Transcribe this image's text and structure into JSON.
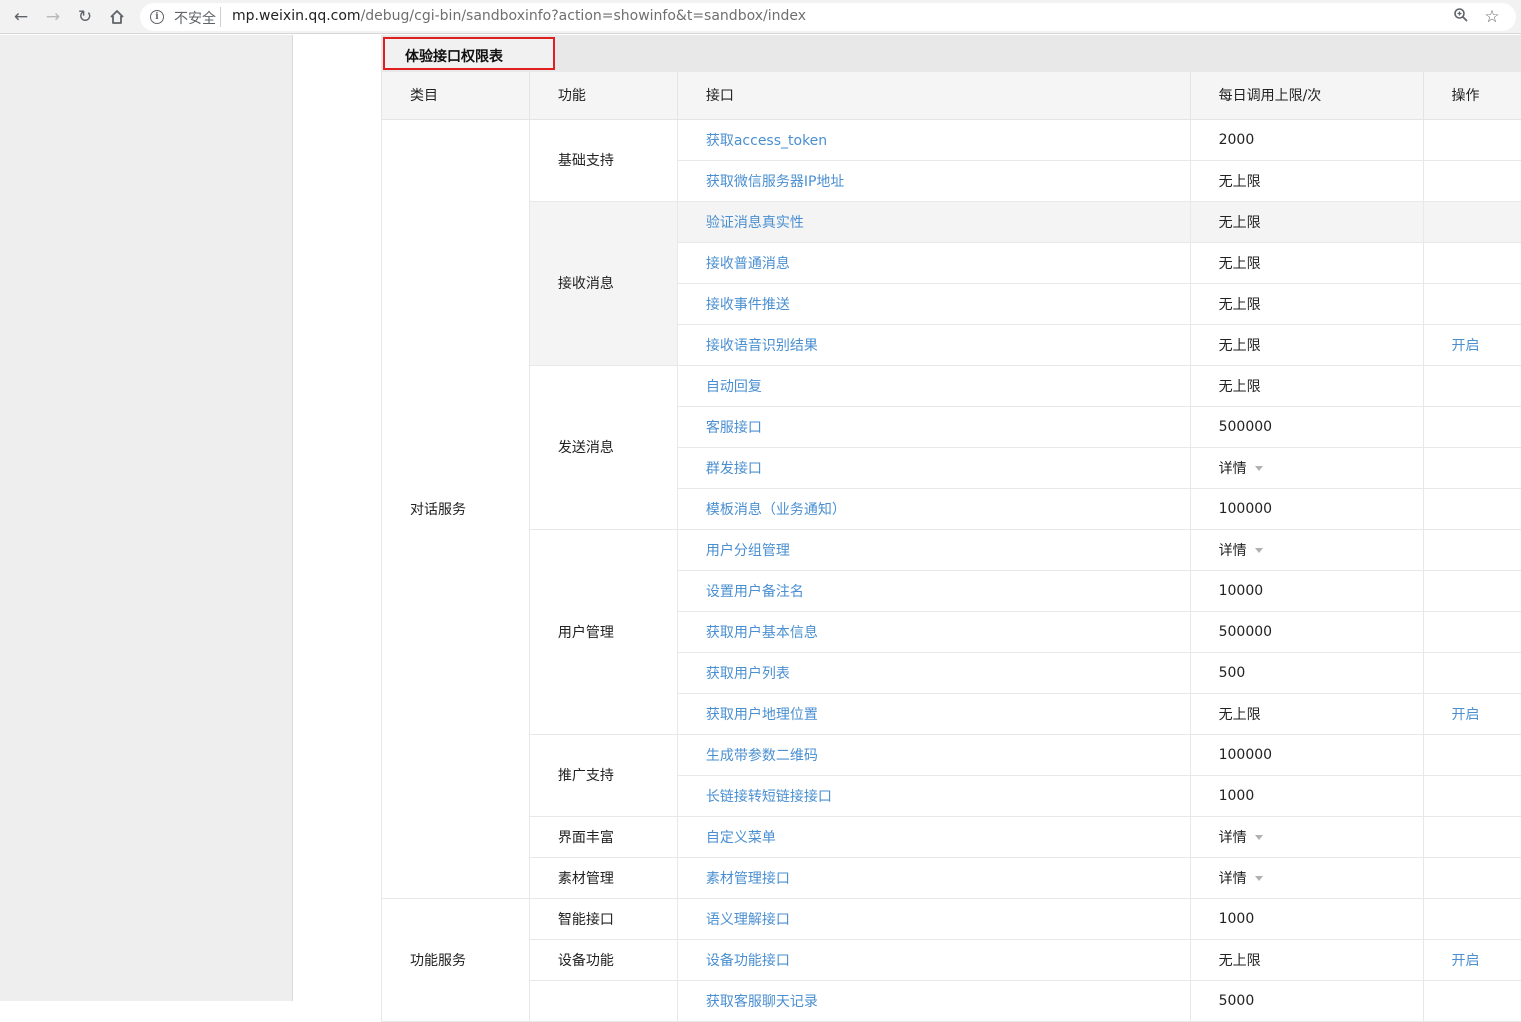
{
  "browser": {
    "security_label": "不安全",
    "url_host": "mp.weixin.qq.com",
    "url_path": "/debug/cgi-bin/sandboxinfo?action=showinfo&t=sandbox/index"
  },
  "page": {
    "title": "体验接口权限表"
  },
  "table": {
    "headers": {
      "category": "类目",
      "function": "功能",
      "api": "接口",
      "limit": "每日调用上限/次",
      "action": "操作"
    },
    "categories": [
      {
        "name": "对话服务",
        "groups": [
          {
            "name": "基础支持",
            "rows": [
              {
                "api": "获取access_token",
                "limit": "2000"
              },
              {
                "api": "获取微信服务器IP地址",
                "limit": "无上限"
              }
            ]
          },
          {
            "name": "接收消息",
            "rows": [
              {
                "api": "验证消息真实性",
                "limit": "无上限"
              },
              {
                "api": "接收普通消息",
                "limit": "无上限"
              },
              {
                "api": "接收事件推送",
                "limit": "无上限"
              },
              {
                "api": "接收语音识别结果",
                "limit": "无上限",
                "action": "开启"
              }
            ]
          },
          {
            "name": "发送消息",
            "rows": [
              {
                "api": "自动回复",
                "limit": "无上限"
              },
              {
                "api": "客服接口",
                "limit": "500000"
              },
              {
                "api": "群发接口",
                "limit": "详情",
                "dropdown": true
              },
              {
                "api": "模板消息（业务通知）",
                "limit": "100000"
              }
            ]
          },
          {
            "name": "用户管理",
            "rows": [
              {
                "api": "用户分组管理",
                "limit": "详情",
                "dropdown": true
              },
              {
                "api": "设置用户备注名",
                "limit": "10000"
              },
              {
                "api": "获取用户基本信息",
                "limit": "500000"
              },
              {
                "api": "获取用户列表",
                "limit": "500"
              },
              {
                "api": "获取用户地理位置",
                "limit": "无上限",
                "action": "开启"
              }
            ]
          },
          {
            "name": "推广支持",
            "rows": [
              {
                "api": "生成带参数二维码",
                "limit": "100000"
              },
              {
                "api": "长链接转短链接接口",
                "limit": "1000"
              }
            ]
          },
          {
            "name": "界面丰富",
            "rows": [
              {
                "api": "自定义菜单",
                "limit": "详情",
                "dropdown": true
              }
            ]
          },
          {
            "name": "素材管理",
            "rows": [
              {
                "api": "素材管理接口",
                "limit": "详情",
                "dropdown": true
              }
            ]
          }
        ]
      },
      {
        "name": "功能服务",
        "groups": [
          {
            "name": "智能接口",
            "rows": [
              {
                "api": "语义理解接口",
                "limit": "1000"
              }
            ]
          },
          {
            "name": "设备功能",
            "rows": [
              {
                "api": "设备功能接口",
                "limit": "无上限",
                "action": "开启"
              }
            ]
          },
          {
            "name": "",
            "rows": [
              {
                "api": "获取客服聊天记录",
                "limit": "5000"
              }
            ]
          }
        ]
      }
    ]
  }
}
